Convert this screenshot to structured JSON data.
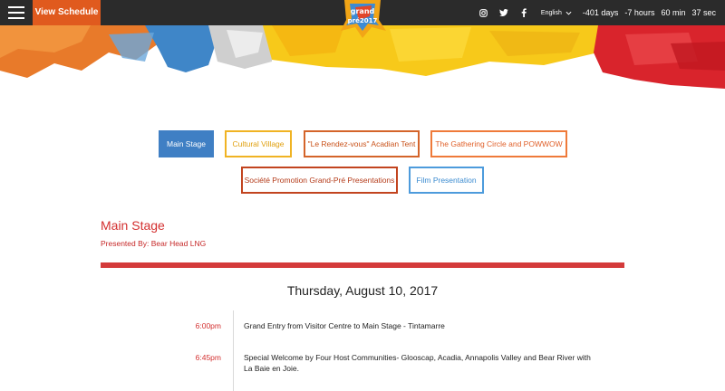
{
  "header": {
    "view_schedule": "View Schedule",
    "language": "English",
    "countdown": {
      "days": "-401 days",
      "hours": "-7 hours",
      "minutes": "60 min",
      "seconds": "37 sec"
    },
    "logo_text_top": "grand",
    "logo_text_bottom": "pré2017"
  },
  "tabs": [
    {
      "label": "Main Stage"
    },
    {
      "label": "Cultural Village"
    },
    {
      "label": "\"Le Rendez-vous\" Acadian Tent"
    },
    {
      "label": "The Gathering Circle and POWWOW"
    },
    {
      "label": "Société Promotion Grand-Pré Presentations"
    },
    {
      "label": "Film Presentation"
    }
  ],
  "main": {
    "title": "Main Stage",
    "presented_by": "Presented By: Bear Head LNG",
    "day": "Thursday, August 10, 2017",
    "events": [
      {
        "time": "6:00pm",
        "description": "Grand Entry from Visitor Centre to Main Stage - Tintamarre"
      },
      {
        "time": "6:45pm",
        "description": "Special Welcome by Four Host Communities- Glooscap, Acadia, Annapolis Valley and Bear River with La Baie en Joie."
      }
    ]
  },
  "colors": {
    "accent_orange": "#e05a1e",
    "active_tab": "#3f7fc4",
    "title_red": "#d32f2f",
    "topbar": "#2b2b2b"
  }
}
